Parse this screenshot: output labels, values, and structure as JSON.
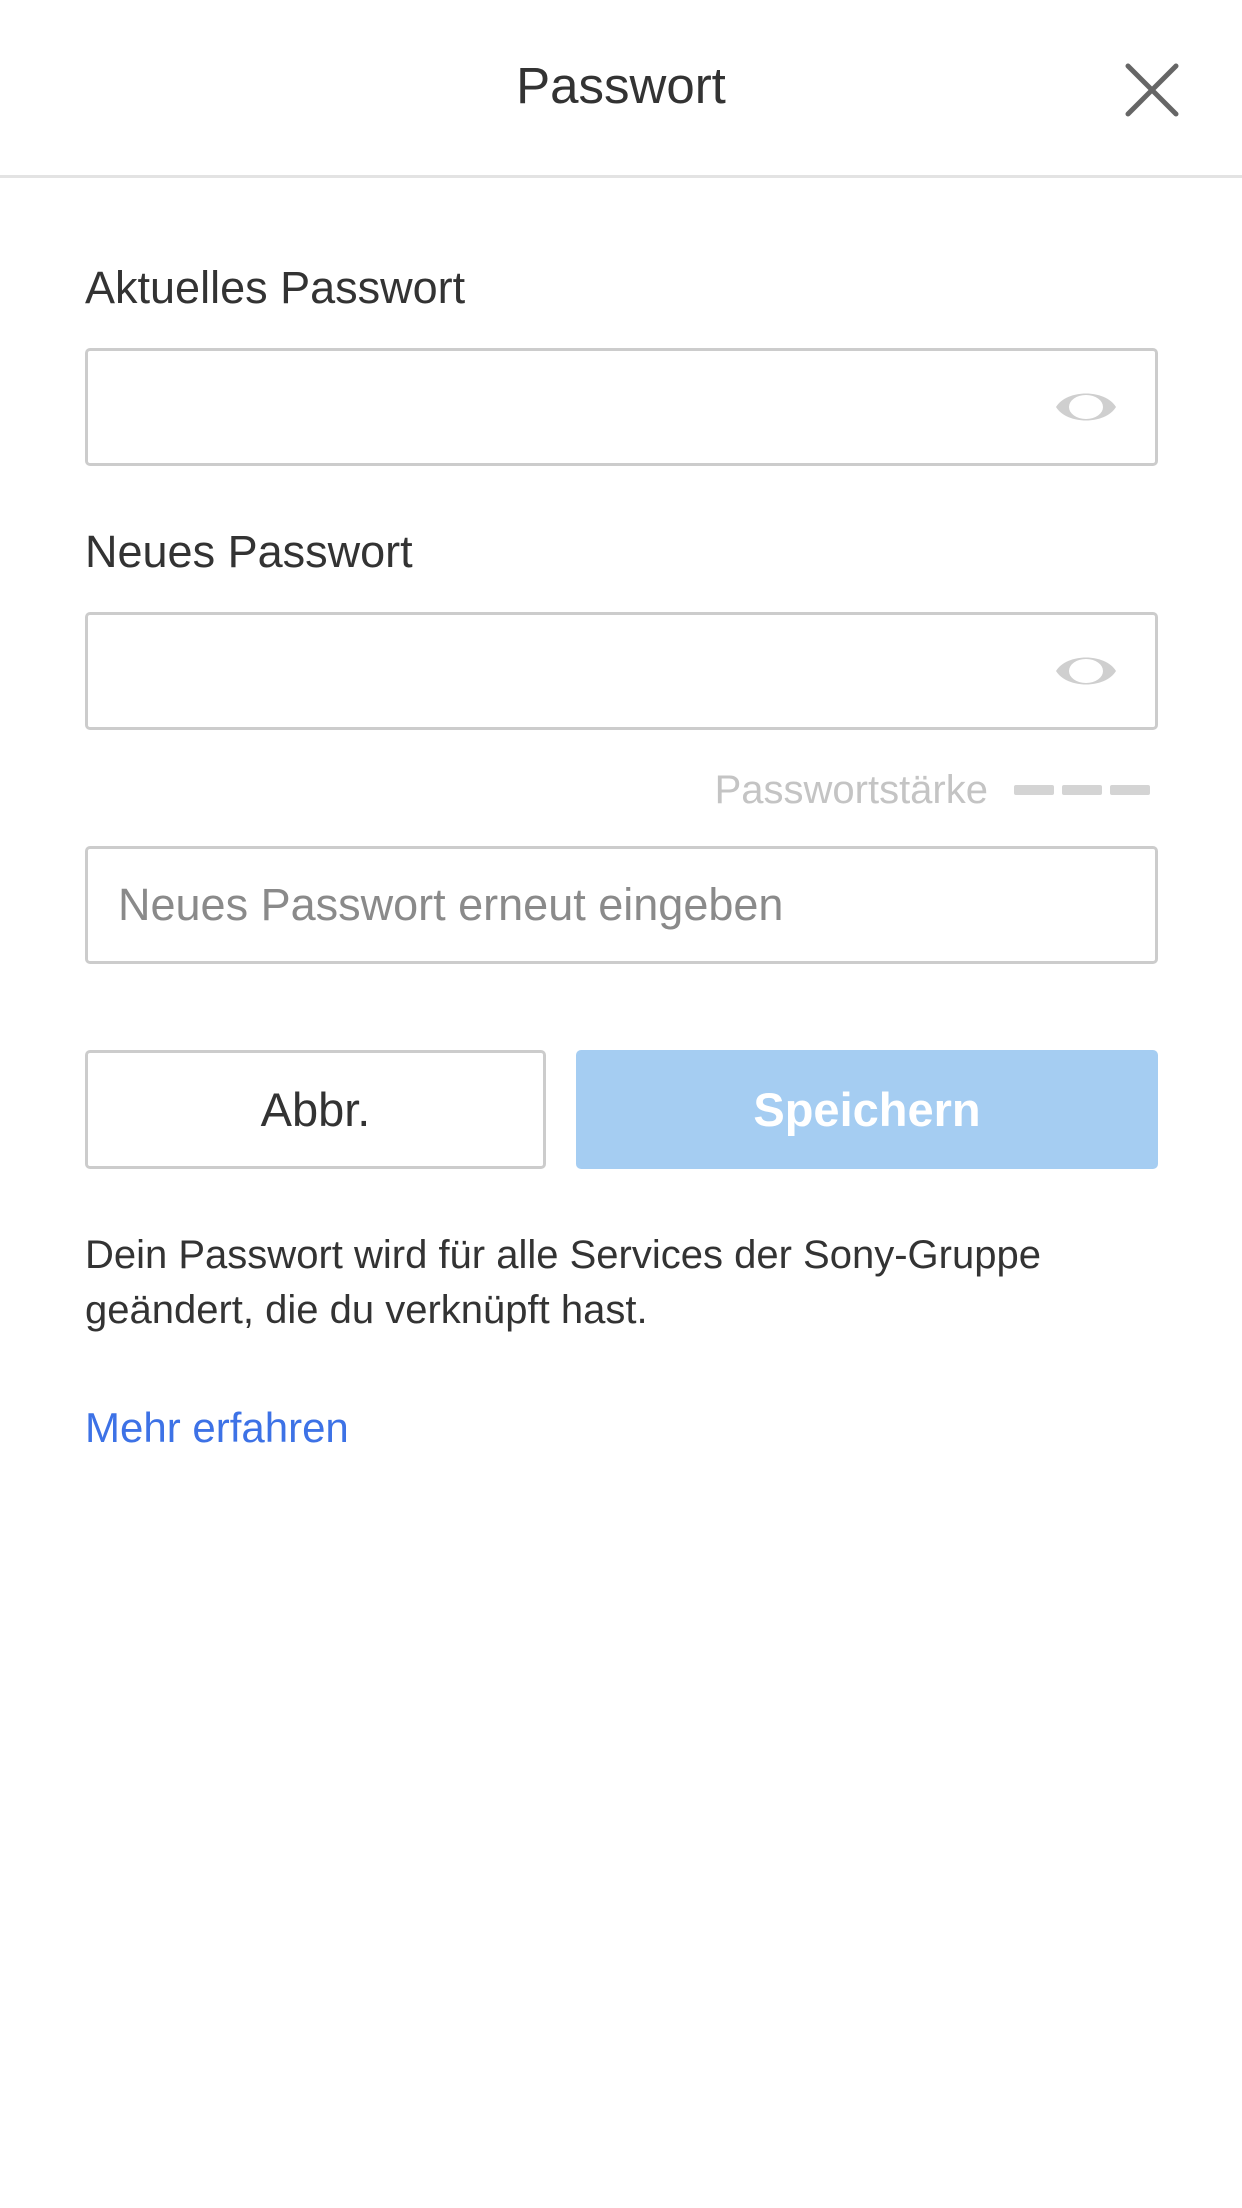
{
  "header": {
    "title": "Passwort",
    "close_icon": "close-icon"
  },
  "form": {
    "current_password": {
      "label": "Aktuelles Passwort",
      "value": "",
      "placeholder": "",
      "toggle_icon": "eye-icon"
    },
    "new_password": {
      "label": "Neues Passwort",
      "value": "",
      "placeholder": "",
      "toggle_icon": "eye-icon"
    },
    "strength": {
      "label": "Passwortstärke",
      "bars": 3
    },
    "confirm_password": {
      "value": "",
      "placeholder": "Neues Passwort erneut eingeben"
    }
  },
  "actions": {
    "cancel_label": "Abbr.",
    "save_label": "Speichern"
  },
  "info": {
    "text": "Dein Passwort wird für alle Services der Sony-Gruppe geändert, die du verknüpft hast.",
    "link_label": "Mehr erfahren"
  },
  "colors": {
    "save_button_bg": "#a5cdf2",
    "link": "#3d72e6",
    "text": "#333333"
  }
}
